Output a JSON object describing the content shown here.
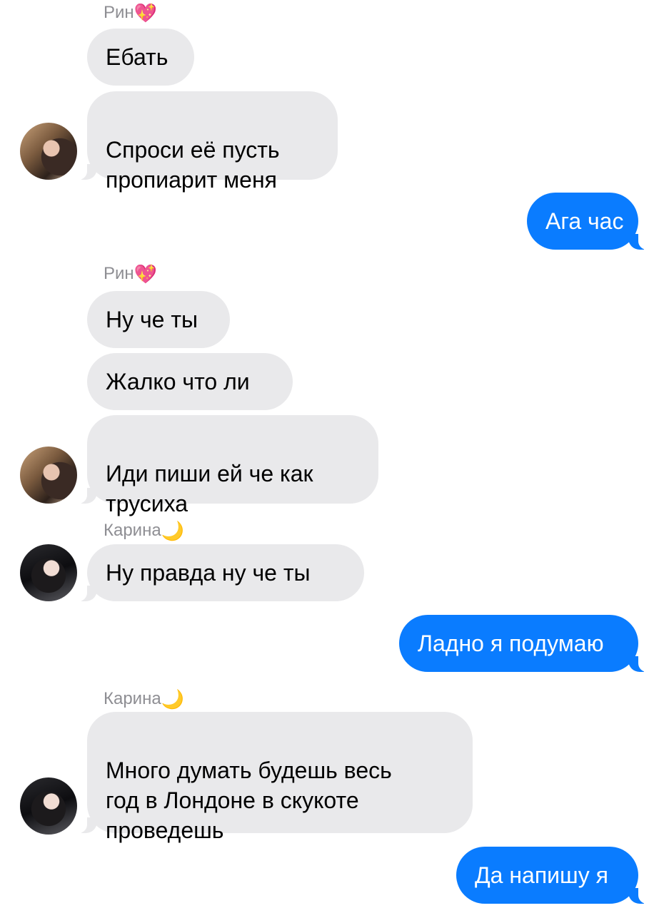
{
  "chat": {
    "messages": [
      {
        "type": "sender",
        "name": "Рин",
        "emoji": "💖"
      },
      {
        "type": "in",
        "text": "Ебать"
      },
      {
        "type": "in",
        "text": "Спроси её пусть\nпропиарит меня",
        "avatar": "rin"
      },
      {
        "type": "out",
        "text": "Ага час"
      },
      {
        "type": "sender",
        "name": "Рин",
        "emoji": "💖"
      },
      {
        "type": "in",
        "text": "Ну че ты"
      },
      {
        "type": "in",
        "text": "Жалко что ли"
      },
      {
        "type": "in",
        "text": "Иди пиши ей че как\nтрусиха",
        "avatar": "rin"
      },
      {
        "type": "sender",
        "name": "Карина",
        "emoji": "🌙"
      },
      {
        "type": "in",
        "text": "Ну правда ну че ты",
        "avatar": "karina"
      },
      {
        "type": "out",
        "text": "Ладно я подумаю"
      },
      {
        "type": "sender",
        "name": "Карина",
        "emoji": "🌙"
      },
      {
        "type": "in",
        "text": "Много думать будешь весь\nгод в Лондоне в скукоте\nпроведешь",
        "avatar": "karina"
      },
      {
        "type": "out",
        "text": "Да напишу я"
      }
    ]
  },
  "colors": {
    "incoming_bubble": "#e9e9eb",
    "outgoing_bubble": "#0a7cff",
    "sender_name": "#8e8e93"
  },
  "icons": {
    "rin_emoji": "sparkling-heart",
    "karina_emoji": "crescent-moon"
  }
}
